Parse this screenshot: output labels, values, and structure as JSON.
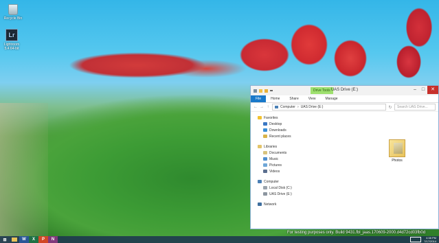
{
  "desktop": {
    "icons": [
      {
        "label": "Recycle Bin",
        "icon": "recycle-bin-icon"
      },
      {
        "label": "Lightroom 5.4 64-bit",
        "icon": "lightroom-icon",
        "glyph": "Lr"
      }
    ]
  },
  "window": {
    "title": "UAS Drive (E:)",
    "contextual_tab": "Drive Tools",
    "ribbon_tabs": [
      "File",
      "Home",
      "Share",
      "View",
      "Manage"
    ],
    "address": [
      "Computer",
      "UAS Drive (E:)"
    ],
    "search_placeholder": "Search UAS Drive...",
    "nav": {
      "favorites_label": "Favorites",
      "favorites": [
        "Desktop",
        "Downloads",
        "Recent places"
      ],
      "libraries_label": "Libraries",
      "libraries": [
        "Documents",
        "Music",
        "Pictures",
        "Videos"
      ],
      "computer_label": "Computer",
      "drives": [
        "Local Disk (C:)",
        "UAS Drive (E:)"
      ],
      "network_label": "Network"
    },
    "items": [
      {
        "name": "Photos",
        "icon": "folder-icon"
      }
    ]
  },
  "watermark": "For testing purposes only. Build 9431.fbl_jaas.170609-2000.d4d72cd03fb0d",
  "taskbar": {
    "apps": [
      {
        "icon": "start-icon",
        "glyph": "⊞"
      },
      {
        "icon": "file-explorer-icon",
        "glyph": ""
      },
      {
        "icon": "word-icon",
        "glyph": "W"
      },
      {
        "icon": "excel-icon",
        "glyph": "X"
      },
      {
        "icon": "powerpoint-icon",
        "glyph": "P"
      },
      {
        "icon": "onenote-icon",
        "glyph": "N"
      }
    ],
    "clock_time": "4:38 PM",
    "clock_date": "7/17/2014"
  },
  "colors": {
    "accent": "#1979ca",
    "drive_tools": "#9ee06e",
    "close": "#c7302b"
  }
}
